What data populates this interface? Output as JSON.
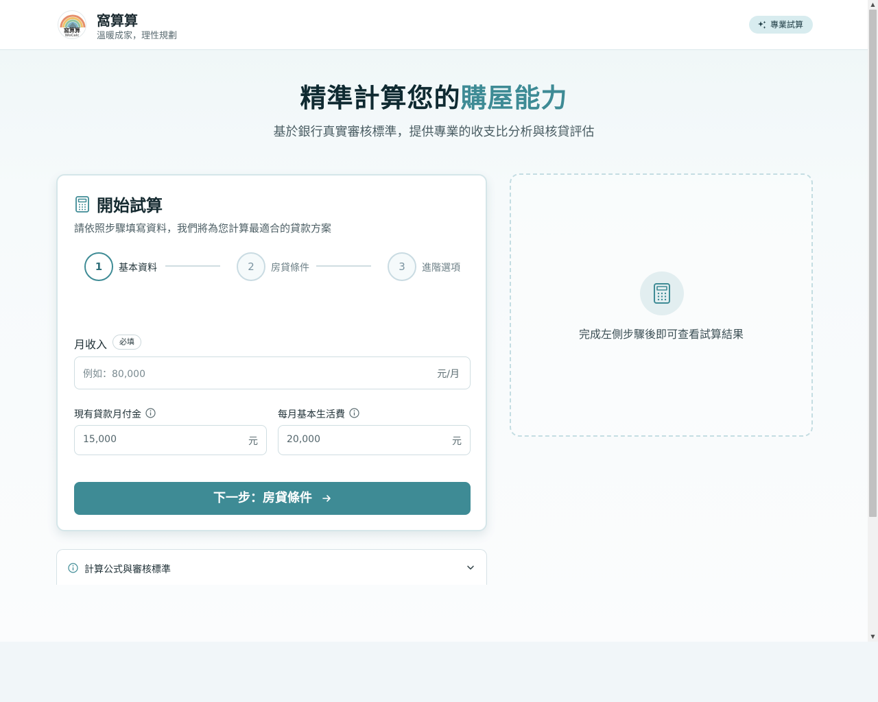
{
  "header": {
    "logo_text": "窩算算",
    "logo_subtext": "WoCalc",
    "brand_name": "窩算算",
    "tagline": "溫暖成家，理性規劃",
    "pro_button": "專業試算"
  },
  "hero": {
    "title_prefix": "精準計算您的",
    "title_highlight": "購屋能力",
    "subtitle": "基於銀行真實審核標準，提供專業的收支比分析與核貸評估"
  },
  "form_card": {
    "title": "開始試算",
    "description": "請依照步驟填寫資料，我們將為您計算最適合的貸款方案",
    "steps": [
      {
        "number": "1",
        "label": "基本資料",
        "active": true
      },
      {
        "number": "2",
        "label": "房貸條件",
        "active": false
      },
      {
        "number": "3",
        "label": "進階選項",
        "active": false
      }
    ],
    "monthly_income": {
      "label": "月收入",
      "required_badge": "必填",
      "placeholder": "例如：80,000",
      "unit": "元/月"
    },
    "existing_loan": {
      "label": "現有貸款月付金",
      "value": "15,000",
      "unit": "元"
    },
    "living_expense": {
      "label": "每月基本生活費",
      "value": "20,000",
      "unit": "元"
    },
    "next_button": "下一步：房貸條件"
  },
  "accordion": {
    "label": "計算公式與審核標準"
  },
  "result_panel": {
    "message": "完成左側步驟後即可查看試算結果"
  },
  "colors": {
    "primary": "#3e8b95",
    "heading": "#0f2a31",
    "pro_button_bg": "#d8ecef"
  }
}
